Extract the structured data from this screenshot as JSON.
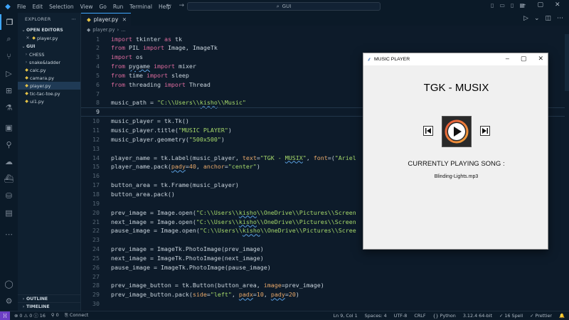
{
  "menu": [
    "File",
    "Edit",
    "Selection",
    "View",
    "Go",
    "Run",
    "Terminal",
    "Help"
  ],
  "command_center": {
    "text": "GUI"
  },
  "sidebar": {
    "title": "EXPLORER",
    "open_editors_label": "OPEN EDITORS",
    "open_editor_file": "player.py",
    "folder_label": "GUI",
    "items": [
      {
        "label": "CHESS",
        "type": "folder"
      },
      {
        "label": "snake&ladder",
        "type": "folder"
      },
      {
        "label": "calc.py",
        "type": "file"
      },
      {
        "label": "camara.py",
        "type": "file"
      },
      {
        "label": "player.py",
        "type": "file",
        "selected": true
      },
      {
        "label": "tic-tac-toe.py",
        "type": "file"
      },
      {
        "label": "ui1.py",
        "type": "file"
      }
    ],
    "outline_label": "OUTLINE",
    "timeline_label": "TIMELINE"
  },
  "tab": {
    "label": "player.py"
  },
  "breadcrumb": {
    "file": "player.py",
    "more": "..."
  },
  "code": {
    "lines": [
      {
        "n": "1",
        "html": "<span class='kw'>import</span> tkinter <span class='kw'>as</span> tk"
      },
      {
        "n": "2",
        "html": "<span class='kw'>from</span> PIL <span class='kw'>import</span> Image, ImageTk"
      },
      {
        "n": "3",
        "html": "<span class='kw'>import</span> os"
      },
      {
        "n": "4",
        "html": "<span class='kw'>from</span> <span class='sq'>pygame</span> <span class='kw'>import</span> mixer"
      },
      {
        "n": "5",
        "html": "<span class='kw'>from</span> time <span class='kw'>import</span> sleep"
      },
      {
        "n": "6",
        "html": "<span class='kw'>from</span> threading <span class='kw'>import</span> Thread"
      },
      {
        "n": "7",
        "html": ""
      },
      {
        "n": "8",
        "html": "music_path = <span class='str'>\"C:\\\\Users\\\\<span class='sq'>kisho</span>\\\\Music\"</span>"
      },
      {
        "n": "9",
        "html": "",
        "current": true
      },
      {
        "n": "10",
        "html": "music_player = tk.Tk()"
      },
      {
        "n": "11",
        "html": "music_player.title(<span class='str'>\"MUSIC PLAYER\"</span>)"
      },
      {
        "n": "12",
        "html": "music_player.geometry(<span class='str'>\"500x500\"</span>)"
      },
      {
        "n": "13",
        "html": ""
      },
      {
        "n": "14",
        "html": "player_name = tk.Label(music_player, <span class='prm'>text</span>=<span class='str'>\"TGK - <span class='sq'>MUSIX</span>\"</span>, <span class='prm'>font</span>=(<span class='str'>\"Ariel</span>"
      },
      {
        "n": "15",
        "html": "player_name.pack(<span class='prm'><span class='sq'>pady</span></span>=<span class='num'>40</span>, <span class='prm'>anchor</span>=<span class='str'>\"center\"</span>)"
      },
      {
        "n": "16",
        "html": ""
      },
      {
        "n": "17",
        "html": "button_area = tk.Frame(music_player)"
      },
      {
        "n": "18",
        "html": "button_area.pack()"
      },
      {
        "n": "19",
        "html": ""
      },
      {
        "n": "20",
        "html": "prev_image = Image.open(<span class='str'>\"C:\\\\Users\\\\<span class='sq'>kisho</span>\\\\OneDrive\\\\Pictures\\\\Screen</span>"
      },
      {
        "n": "21",
        "html": "next_image = Image.open(<span class='str'>\"C:\\\\Users\\\\<span class='sq'>kisho</span>\\\\OneDrive\\\\Pictures\\\\Screen</span>"
      },
      {
        "n": "22",
        "html": "pause_image = Image.open(<span class='str'>\"C:\\\\Users\\\\<span class='sq'>kisho</span>\\\\OneDrive\\\\Pictures\\\\Scree</span>"
      },
      {
        "n": "23",
        "html": ""
      },
      {
        "n": "24",
        "html": "prev_image = ImageTk.PhotoImage(prev_image)"
      },
      {
        "n": "25",
        "html": "next_image = ImageTk.PhotoImage(next_image)"
      },
      {
        "n": "26",
        "html": "pause_image = ImageTk.PhotoImage(pause_image)"
      },
      {
        "n": "27",
        "html": ""
      },
      {
        "n": "28",
        "html": "prev_image_button = tk.Button(button_area, <span class='prm'>image</span>=prev_image)"
      },
      {
        "n": "29",
        "html": "prev_image_button.pack(<span class='prm'>side</span>=<span class='str'>\"left\"</span>, <span class='prm'><span class='sq'>padx</span></span>=<span class='num'>10</span>, <span class='prm'><span class='sq'>pady</span></span>=<span class='num'>20</span>)"
      },
      {
        "n": "30",
        "html": ""
      },
      {
        "n": "31",
        "html": "pause_image_button = tk.Button(button_area, <span class='prm'>image</span>=pause_image)"
      }
    ]
  },
  "player_window": {
    "title": "MUSIC PLAYER",
    "heading": "TGK - MUSIX",
    "current_label": "CURRENTLY PLAYING SONG :",
    "song": "Blinding-Lights.mp3"
  },
  "statusbar": {
    "problems": "0 ⚠ 0 ⓘ 16",
    "ports": "0",
    "connect": "Connect",
    "position": "Ln 9, Col 1",
    "spaces": "Spaces: 4",
    "encoding": "UTF-8",
    "eol": "CRLF",
    "language": "Python",
    "interpreter": "3.12.4 64-bit",
    "spell": "16 Spell",
    "prettier": "Prettier"
  }
}
